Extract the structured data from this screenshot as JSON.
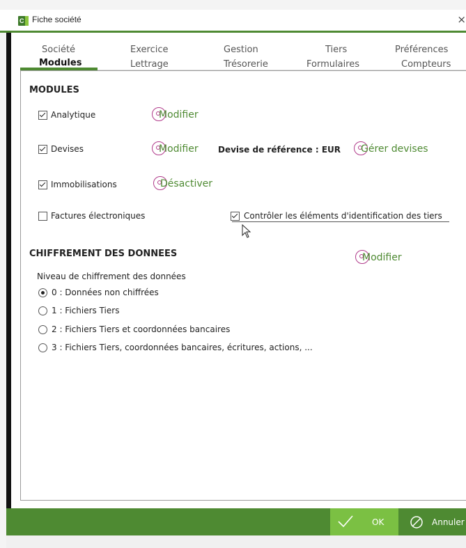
{
  "window": {
    "title": "Fiche société",
    "close_glyph": "×",
    "app_icon": "C"
  },
  "tabs_row1": [
    "Société",
    "Exercice",
    "Gestion",
    "Tiers",
    "Préférences"
  ],
  "tabs_row2": [
    "Modules",
    "Lettrage",
    "Trésorerie",
    "Formulaires",
    "Compteurs"
  ],
  "active_tab": "Modules",
  "modules": {
    "title": "MODULES",
    "analytique": {
      "label": "Analytique",
      "checked": true,
      "action": "Modifier"
    },
    "devises": {
      "label": "Devises",
      "checked": true,
      "action": "Modifier",
      "ref_label": "Devise de référence : EUR",
      "manage_action": "Gérer devises"
    },
    "immobilisations": {
      "label": "Immobilisations",
      "checked": true,
      "action": "Désactiver"
    },
    "factures": {
      "label": "Factures électroniques",
      "checked": false
    },
    "controler": {
      "label": "Contrôler les éléments d'identification des tiers",
      "checked": true
    }
  },
  "chiffrement": {
    "title": "CHIFFREMENT DES DONNEES",
    "action": "Modifier",
    "level_label": "Niveau de chiffrement des données",
    "options": [
      "0 : Données non chiffrées",
      "1 : Fichiers Tiers",
      "2 : Fichiers Tiers et coordonnées bancaires",
      "3 : Fichiers Tiers, coordonnées bancaires, écritures, actions, ..."
    ],
    "selected_index": 0
  },
  "footer": {
    "ok_label": "OK",
    "cancel_label": "Annuler"
  },
  "icons": {
    "app": "cegid-app-icon",
    "check": "check-icon",
    "cancel": "cancel-icon",
    "action": "action-ring-icon",
    "cursor": "mouse-cursor-icon"
  },
  "colors": {
    "accent_green": "#4e8a32",
    "ok_green": "#7bc043",
    "ring_magenta": "#b03a8a"
  }
}
